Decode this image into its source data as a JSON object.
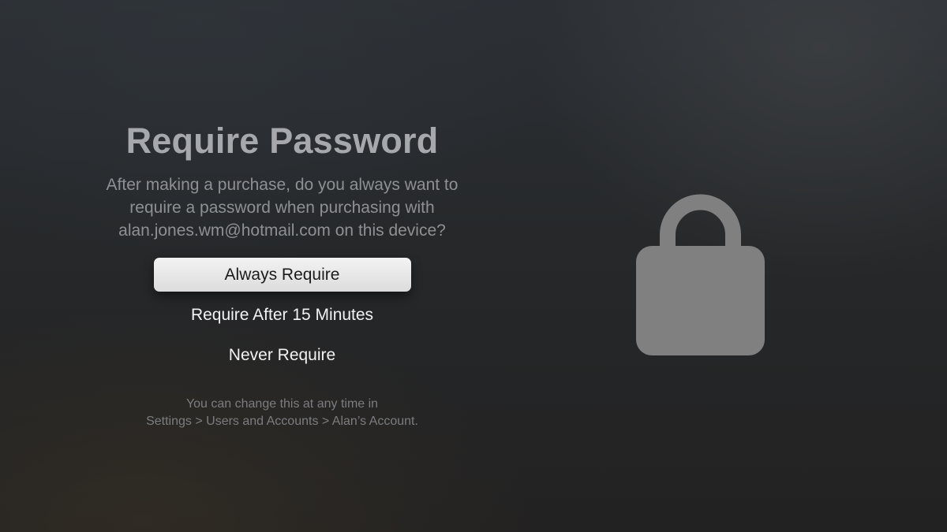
{
  "dialog": {
    "title": "Require Password",
    "message_lines": [
      "After making a purchase, do you always want to",
      "require a password when purchasing with",
      "alan.jones.wm@hotmail.com on this device?"
    ],
    "options": [
      {
        "label": "Always Require",
        "focused": true
      },
      {
        "label": "Require After 15 Minutes",
        "focused": false
      },
      {
        "label": "Never Require",
        "focused": false
      }
    ],
    "footnote_lines": [
      "You can change this at any time in",
      "Settings > Users and Accounts > Alan’s Account."
    ]
  },
  "icon": {
    "name": "lock-icon",
    "color": "#808080"
  },
  "colors": {
    "focused_button_bg": "#e9e9e9",
    "focused_button_text": "#1b1b1b",
    "option_text": "#f2f2f2",
    "title_text": "#a6a8ab"
  }
}
